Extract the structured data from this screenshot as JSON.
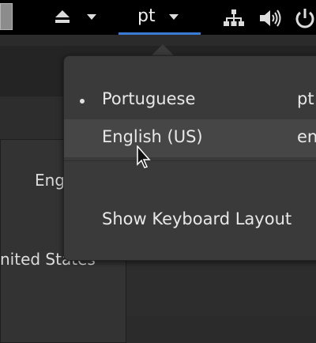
{
  "top_bar": {
    "language_indicator": "pt",
    "icons": [
      "eject-icon",
      "chevron-down-icon",
      "network-icon",
      "volume-icon",
      "power-icon"
    ]
  },
  "background": {
    "text_1": "Eng",
    "text_2": "nited States"
  },
  "keyboard_menu": {
    "items": [
      {
        "label": "Portuguese",
        "code": "pt",
        "selected": true
      },
      {
        "label": "English (US)",
        "code": "en",
        "selected": false
      }
    ],
    "show_layout_label": "Show Keyboard Layout"
  },
  "colors": {
    "accent_underline": "#3a7cd4",
    "topbar": "#000000",
    "menu_background": "#3a3a3a"
  }
}
